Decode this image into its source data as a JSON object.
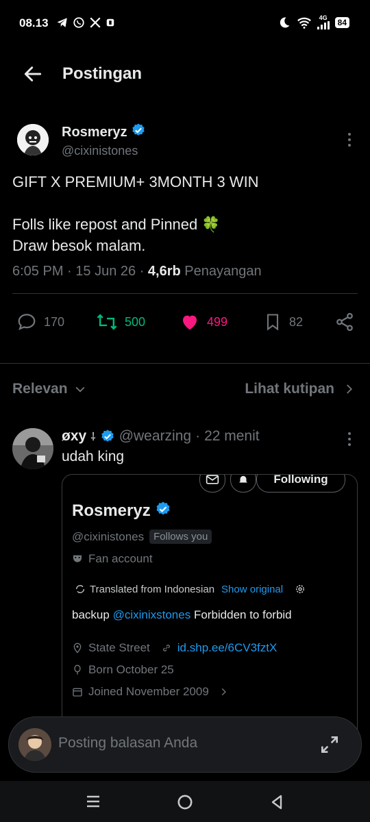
{
  "status_bar": {
    "time": "08.13",
    "signal_label": "4G",
    "battery": "84",
    "icons_left": [
      "telegram-icon",
      "whatsapp-icon",
      "x-logo-icon",
      "app-icon"
    ],
    "icons_right": [
      "moon-icon",
      "wifi-icon",
      "signal-icon",
      "battery-icon"
    ]
  },
  "header": {
    "title": "Postingan",
    "back_icon": "arrow-left-icon"
  },
  "post": {
    "author_name": "Rosmeryz",
    "author_handle": "@cixinistones",
    "text_line1": "GIFT X PREMIUM+ 3MONTH 3 WIN",
    "text_line2": "Folls like repost and Pinned 🍀",
    "text_line3": "Draw besok malam.",
    "time": "6:05 PM",
    "date": "15 Jun 26",
    "views_count": "4,6rb",
    "views_label": "Penayangan",
    "replies": "170",
    "reposts": "500",
    "likes": "499",
    "bookmarks": "82"
  },
  "filter": {
    "sort_label": "Relevan",
    "quotes_label": "Lihat kutipan"
  },
  "reply": {
    "name": "øxy",
    "name_suffix": "⸸",
    "handle": "@wearzing",
    "time": "22 menit",
    "text": "udah king",
    "card": {
      "following_label": "Following",
      "name": "Rosmeryz",
      "handle": "@cixinistones",
      "follows_you": "Follows you",
      "category": "Fan account",
      "translated_label": "Translated from Indonesian",
      "show_original": "Show original",
      "bio_prefix": "backup",
      "bio_mention": "@cixinixstones",
      "bio_suffix": "Forbidden to forbid",
      "location": "State Street",
      "link": "id.shp.ee/6CV3fztX",
      "born": "Born October 25",
      "joined": "Joined November 2009"
    }
  },
  "composer": {
    "placeholder": "Posting balasan Anda"
  },
  "colors": {
    "background": "#000000",
    "text": "#e7e9ea",
    "muted": "#71767b",
    "accent": "#1d9bf0",
    "repost": "#00ba7c",
    "like": "#f91880",
    "divider": "#2f3336"
  }
}
